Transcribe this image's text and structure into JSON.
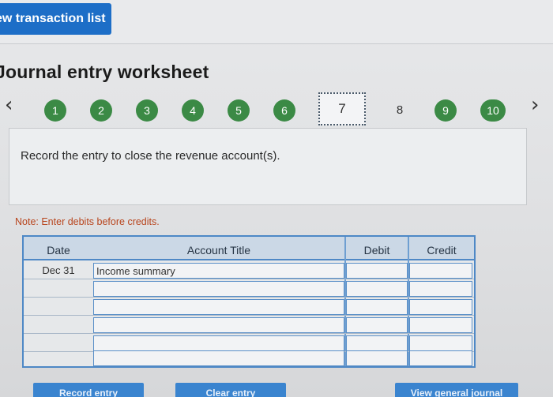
{
  "header": {
    "view_list_label": "ew transaction list"
  },
  "worksheet": {
    "title": "Journal entry worksheet",
    "steps": [
      "1",
      "2",
      "3",
      "4",
      "5",
      "6",
      "7",
      "8",
      "9",
      "10"
    ],
    "current_step": "7",
    "prompt": "Record the entry to close the revenue account(s).",
    "note": "Note: Enter debits before credits."
  },
  "journal": {
    "columns": {
      "date": "Date",
      "account": "Account Title",
      "debit": "Debit",
      "credit": "Credit"
    },
    "rows": [
      {
        "date": "Dec 31",
        "account": "Income summary",
        "debit": "",
        "credit": ""
      },
      {
        "date": "",
        "account": "",
        "debit": "",
        "credit": ""
      },
      {
        "date": "",
        "account": "",
        "debit": "",
        "credit": ""
      },
      {
        "date": "",
        "account": "",
        "debit": "",
        "credit": ""
      },
      {
        "date": "",
        "account": "",
        "debit": "",
        "credit": ""
      },
      {
        "date": "",
        "account": "",
        "debit": "",
        "credit": ""
      }
    ]
  },
  "actions": {
    "record_label": "Record entry",
    "clear_label": "Clear entry",
    "view_journal_label": "View general journal"
  },
  "colors": {
    "primary": "#1d6ec7",
    "step_done": "#3b8a45",
    "note": "#b8451d"
  }
}
